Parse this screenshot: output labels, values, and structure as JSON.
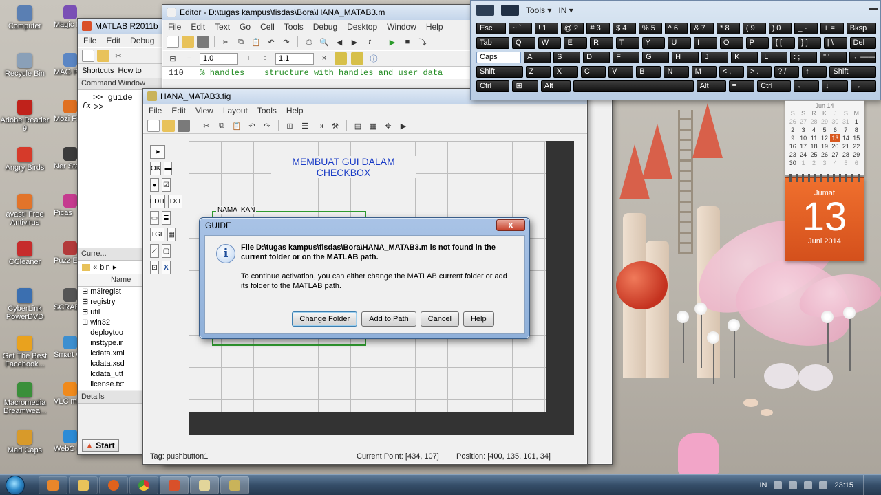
{
  "desktop": {
    "icons": [
      {
        "label": "Computer",
        "color": "#5a7fb3"
      },
      {
        "label": "Recycle Bin",
        "color": "#8aa0b8"
      },
      {
        "label": "Adobe Reader 9",
        "color": "#c0221b"
      },
      {
        "label": "Angry Birds",
        "color": "#d63a2a"
      },
      {
        "label": "avast! Free Antivirus",
        "color": "#e2742a"
      },
      {
        "label": "CCleaner",
        "color": "#c62c2c"
      },
      {
        "label": "CyberLink PowerDVD",
        "color": "#3b6fb0"
      },
      {
        "label": "Get The Best Facebook...",
        "color": "#e9a21e"
      },
      {
        "label": "Macromedia Dreamwea...",
        "color": "#3a8f3a"
      },
      {
        "label": "Mad Caps",
        "color": "#d89a2a"
      }
    ],
    "icons_col2": [
      {
        "label": "Magic I New W",
        "color": "#7a4fb5"
      },
      {
        "label": "MAG Photo",
        "color": "#5b86c4"
      },
      {
        "label": "Mozi Firef",
        "color": "#e07021"
      },
      {
        "label": "Ner Start",
        "color": "#3b3b3b"
      },
      {
        "label": "Picas",
        "color": "#c53b8f"
      },
      {
        "label": "Puzz Expre",
        "color": "#b33a3a"
      },
      {
        "label": "SCRAE",
        "color": "#555"
      },
      {
        "label": "Smart Conn",
        "color": "#3d8fd0"
      },
      {
        "label": "VLC m play",
        "color": "#f08a1c"
      },
      {
        "label": "WebC Compan",
        "color": "#2c8bd6"
      }
    ]
  },
  "osk": {
    "title_tools": "Tools",
    "lang": "IN",
    "rows": [
      [
        "Esc",
        "~ `",
        "! 1",
        "@ 2",
        "# 3",
        "$ 4",
        "% 5",
        "^ 6",
        "& 7",
        "* 8",
        "( 9",
        ") 0",
        "_ -",
        "+ =",
        "Bksp"
      ],
      [
        "Tab",
        "Q",
        "W",
        "E",
        "R",
        "T",
        "Y",
        "U",
        "I",
        "O",
        "P",
        "{ [",
        "} ]",
        "| \\",
        "Del"
      ],
      [
        "Caps",
        "A",
        "S",
        "D",
        "F",
        "G",
        "H",
        "J",
        "K",
        "L",
        ": ;",
        "\" '",
        "←——"
      ],
      [
        "Shift",
        "Z",
        "X",
        "C",
        "V",
        "B",
        "N",
        "M",
        "< ,",
        "> .",
        "? /",
        "↑",
        "Shift"
      ],
      [
        "Ctrl",
        "⊞",
        "Alt",
        "",
        "Alt",
        "≡",
        "Ctrl",
        "←",
        "↓",
        "→"
      ]
    ]
  },
  "calendar": {
    "month": "Jun 14",
    "weekdays": [
      "S",
      "S",
      "R",
      "K",
      "J",
      "S",
      "M"
    ],
    "days": [
      [
        "26",
        "27",
        "28",
        "29",
        "30",
        "31",
        "1"
      ],
      [
        "2",
        "3",
        "4",
        "5",
        "6",
        "7",
        "8"
      ],
      [
        "9",
        "10",
        "11",
        "12",
        "13",
        "14",
        "15"
      ],
      [
        "16",
        "17",
        "18",
        "19",
        "20",
        "21",
        "22"
      ],
      [
        "23",
        "24",
        "25",
        "26",
        "27",
        "28",
        "29"
      ],
      [
        "30",
        "1",
        "2",
        "3",
        "4",
        "5",
        "6"
      ]
    ],
    "day_name": "Jumat",
    "day_number": "13",
    "month_year": "Juni 2014"
  },
  "matlab": {
    "title": "MATLAB  R2011b",
    "menu": [
      "File",
      "Edit",
      "Debug"
    ],
    "shortcuts": "Shortcuts",
    "howto": "How to",
    "command_window": "Command Window",
    "cmd_lines": [
      ">> guide",
      ">>"
    ],
    "fx": "fx",
    "current_folder": "Curre...",
    "folder_path": "bin",
    "name_header": "Name",
    "files": [
      "m3iregist",
      "registry",
      "util",
      "win32",
      "deploytoo",
      "insttype.ir",
      "lcdata.xml",
      "lcdata.xsd",
      "lcdata_utf",
      "license.txt"
    ],
    "details": "Details",
    "start": "Start"
  },
  "editor": {
    "title": "Editor - D:\\tugas kampus\\fisdas\\Bora\\HANA_MATAB3.m",
    "menu": [
      "File",
      "Edit",
      "Text",
      "Go",
      "Cell",
      "Tools",
      "Debug",
      "Desktop",
      "Window",
      "Help"
    ],
    "field1": "1.0",
    "field2": "1.1",
    "line_number": "110",
    "code": "  % handles    structure with handles and user data"
  },
  "fig": {
    "title": "HANA_MATAB3.fig",
    "menu": [
      "File",
      "Edit",
      "View",
      "Layout",
      "Tools",
      "Help"
    ],
    "gui_title_line1": "MEMBUAT GUI DALAM",
    "gui_title_line2": "CHECKBOX",
    "panel_label": "NAMA IKAN",
    "status_tag": "Tag: pushbutton1",
    "status_point": "Current Point:  [434, 107]",
    "status_position": "Position: [400, 135, 101, 34]"
  },
  "dialog": {
    "title": "GUIDE",
    "close": "x",
    "message_bold": "File D:\\tugas kampus\\fisdas\\Bora\\HANA_MATAB3.m is not found in the current folder or on the MATLAB path.",
    "message": "To continue activation, you can either change the MATLAB current folder or add its folder to the MATLAB path.",
    "buttons": {
      "change_folder": "Change Folder",
      "add_to_path": "Add to Path",
      "cancel": "Cancel",
      "help": "Help"
    }
  },
  "taskbar": {
    "lang": "IN",
    "time": "23:15"
  }
}
